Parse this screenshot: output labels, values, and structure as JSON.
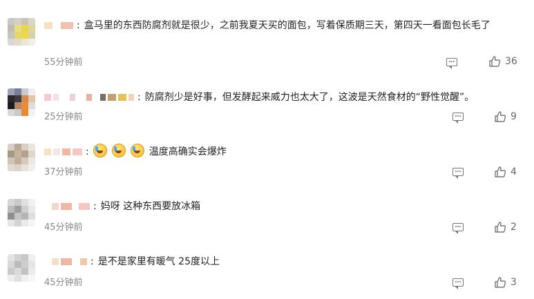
{
  "comments": [
    {
      "text": "盒马里的东西防腐剂就是很少，之前我夏天买的面包，写着保质期三天，第四天一看面包长毛了",
      "time": "55分钟前",
      "likes": "36"
    },
    {
      "text": "防腐剂少是好事，但发酵起来威力也太大了，这波是天然食材的“野性觉醒”。",
      "time": "25分钟前",
      "likes": "9"
    },
    {
      "text": "温度高确实会爆炸",
      "time": "37分钟前",
      "likes": "4",
      "emoji_count": 3
    },
    {
      "text": "妈呀 这种东西要放冰箱",
      "time": "45分钟前",
      "likes": "2"
    },
    {
      "text": "是不是家里有暖气 25度以上",
      "time": "45分钟前",
      "likes": "3"
    }
  ],
  "icons": {
    "reply": "comment-reply-icon",
    "like": "thumbs-up-icon",
    "emoji": "laugh-cry-emoji-icon"
  },
  "colors": {
    "text": "#222222",
    "meta": "#888888",
    "icon": "#666666"
  }
}
